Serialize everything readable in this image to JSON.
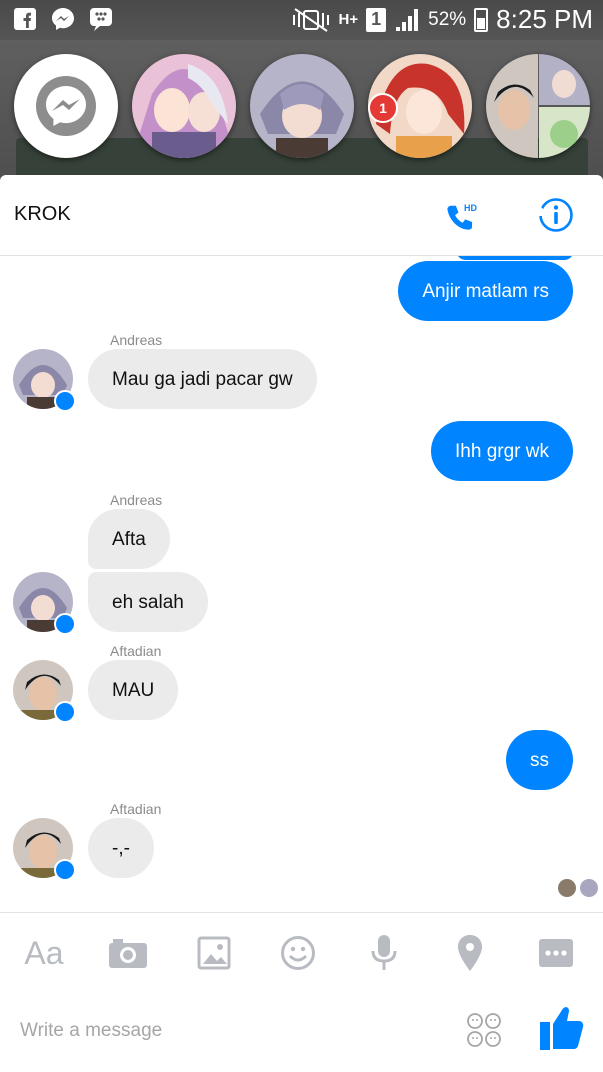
{
  "status_bar": {
    "battery": "52%",
    "sim": "1",
    "network": "H+",
    "time": "8:25 PM"
  },
  "chat_heads": {
    "unread_badge": "1"
  },
  "conversation": {
    "title": "KROK",
    "call_hd_label": "HD",
    "messages": [
      {
        "direction": "out",
        "text": "Anjir matlam rs"
      },
      {
        "direction": "in",
        "sender": "Andreas",
        "text": "Mau ga jadi pacar gw"
      },
      {
        "direction": "out",
        "text": "Ihh grgr wk"
      },
      {
        "direction": "in",
        "sender": "Andreas",
        "text": "Afta"
      },
      {
        "direction": "in",
        "text": "eh salah"
      },
      {
        "direction": "in",
        "sender": "Aftadian",
        "text": "MAU"
      },
      {
        "direction": "out",
        "text": "ss"
      },
      {
        "direction": "in",
        "sender": "Aftadian",
        "text": "-,-"
      }
    ]
  },
  "toolbar": {
    "text_mode_label": "Aa",
    "icons": [
      "camera-icon",
      "gallery-icon",
      "emoji-icon",
      "microphone-icon",
      "location-icon",
      "more-icon"
    ]
  },
  "composer": {
    "placeholder": "Write a message",
    "send_icon": "thumbs-up-icon"
  },
  "colors": {
    "accent": "#0084ff",
    "incoming_bubble": "#ebebeb",
    "toolbar_icon": "#b8bcc2"
  }
}
